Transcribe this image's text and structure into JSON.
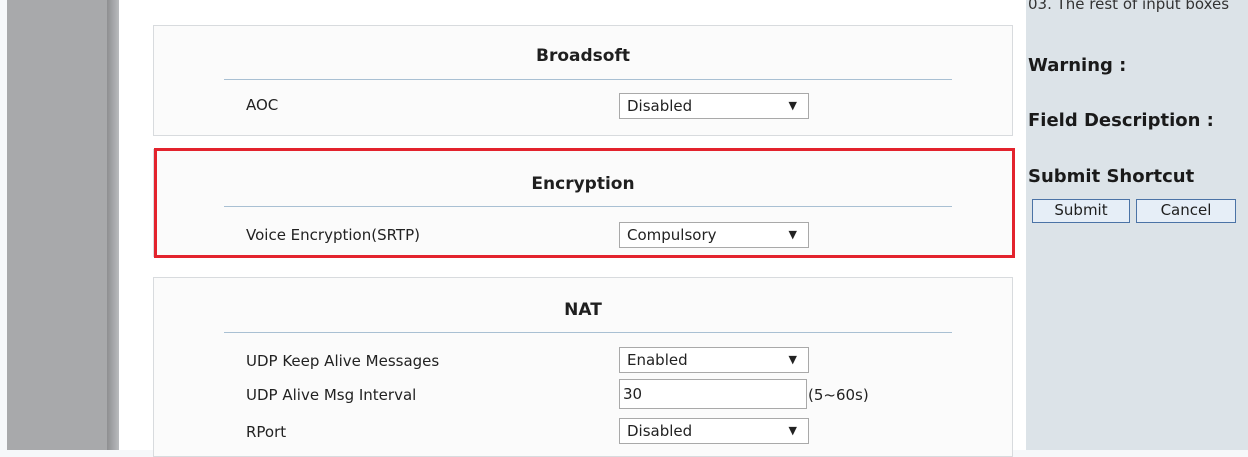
{
  "right_panel": {
    "cut_text": "03. The rest of input boxes",
    "warning_heading": "Warning :",
    "field_description_heading": "Field Description :",
    "submit_shortcut_heading": "Submit Shortcut",
    "submit_label": "Submit",
    "cancel_label": "Cancel"
  },
  "broadsoft": {
    "title": "Broadsoft",
    "aoc_label": "AOC",
    "aoc_value": "Disabled"
  },
  "encryption": {
    "title": "Encryption",
    "voice_label": "Voice Encryption(SRTP)",
    "voice_value": "Compulsory"
  },
  "nat": {
    "title": "NAT",
    "udp_keep_alive_label": "UDP Keep Alive Messages",
    "udp_keep_alive_value": "Enabled",
    "udp_interval_label": "UDP Alive Msg Interval",
    "udp_interval_value": "30",
    "udp_interval_hint": "(5~60s)",
    "rport_label": "RPort",
    "rport_value": "Disabled"
  },
  "icons": {
    "dropdown": "chevron-down-icon"
  },
  "colors": {
    "highlight": "#e3232d",
    "rule": "#a9c0d3",
    "panel": "#dce3e8"
  }
}
